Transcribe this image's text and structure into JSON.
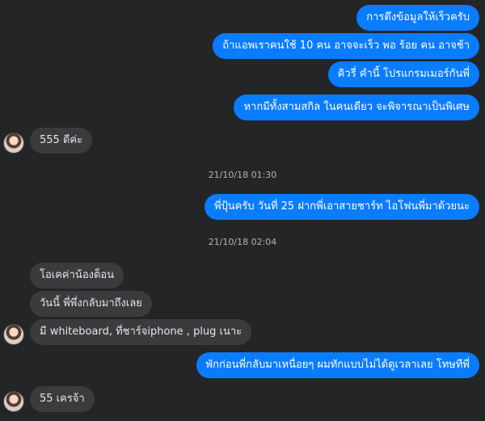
{
  "messages": [
    {
      "text": "การดึงข้อมูลให้เร็วครับ"
    },
    {
      "text": "ถ้าแอพเราคนใช้ 10 คน อาจจะเร็ว พอ ร้อย คน อาจช้า"
    },
    {
      "text": "คิวรี่ คำนี้ โปรแกรมเมอร์กันพี่"
    },
    {
      "text": "หากมีทั้งสามสกิล ในคนเดียว จะพิจารณาเป็นพิเศษ"
    },
    {
      "text": "555 ดีค่ะ"
    },
    {
      "text": "พี่ปุ้นครับ วันที่ 25 ฝากพี่เอาสายชาร์ท ไอโฟนพี่มาด้วยนะ"
    },
    {
      "text": "โอเคค่าน้องต็อน"
    },
    {
      "text": "วันนี้ พี่พึ่งกลับมาถึงเลย"
    },
    {
      "text": "มี whiteboard, ที่ชาร์จiphone , plug เนาะ"
    },
    {
      "text": "พักก่อนพี่กลับมาเหนื่อยๆ ผมทักแบบไม่ได้ดูเวลาเลย โทษทีพี่"
    },
    {
      "text": "55 เครจ้า"
    }
  ],
  "timestamps": [
    "21/10/18 01:30",
    "21/10/18 02:04"
  ],
  "colors": {
    "background": "#242526",
    "outgoing_bubble": "#0a7cff",
    "incoming_bubble": "#3a3b3c",
    "timestamp_text": "#b0b3b8"
  }
}
